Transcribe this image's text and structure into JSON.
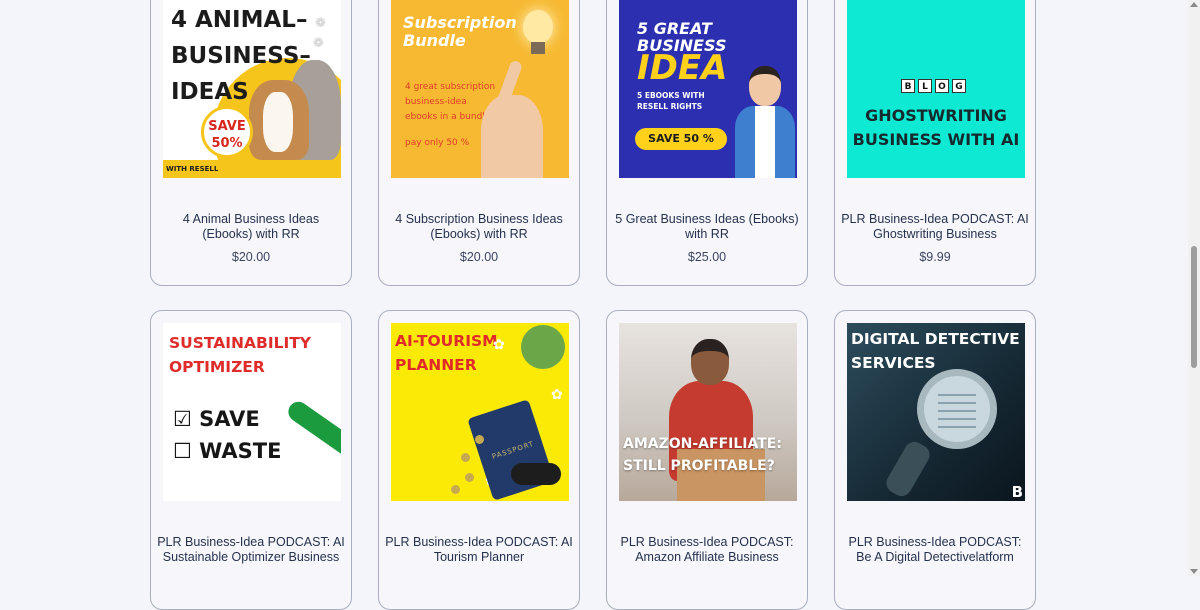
{
  "products": [
    {
      "title": "4 Animal Business Ideas (Ebooks) with RR",
      "price": "$20.00",
      "image_text": {
        "headline": "4 ANIMAL– BUSINESS– IDEAS",
        "line1": "4 ANIMAL–",
        "line2": "BUSINESS–",
        "line3": "IDEAS",
        "badge": "SAVE 50%",
        "badge1": "SAVE",
        "badge2": "50%",
        "footer": "WITH RESELL RIGHTS"
      }
    },
    {
      "title": "4 Subscription Business Ideas (Ebooks) with RR",
      "price": "$20.00",
      "image_text": {
        "line1": "Subscription",
        "line2": "Bundle",
        "desc1": "4 great subscription",
        "desc2": "business-idea",
        "desc3": "ebooks in a bundle",
        "offer": "pay only 50 %"
      }
    },
    {
      "title": "5 Great Business Ideas (Ebooks) with RR",
      "price": "$25.00",
      "image_text": {
        "line1": "5 GREAT",
        "line2": "BUSINESS",
        "big": "IDEA",
        "sub1": "5 EBOOKS WITH",
        "sub2": "RESELL RIGHTS",
        "badge": "SAVE 50 %"
      }
    },
    {
      "title": "PLR Business-Idea PODCAST: AI Ghostwriting Business",
      "price": "$9.99",
      "image_text": {
        "tiles": [
          "B",
          "L",
          "O",
          "G"
        ],
        "line1": "GHOSTWRITING",
        "line2": "BUSINESS WITH AI"
      }
    },
    {
      "title": "PLR Business-Idea PODCAST: AI Sustainable Optimizer Business",
      "image_text": {
        "line1": "SUSTAINABILITY",
        "line2": "OPTIMIZER",
        "opt1": "SAVE",
        "opt2": "WASTE"
      }
    },
    {
      "title": "PLR Business-Idea PODCAST: AI Tourism Planner",
      "image_text": {
        "line1": "AI-TOURISM",
        "line2": "PLANNER",
        "passport": "PASSPORT"
      }
    },
    {
      "title": "PLR Business-Idea PODCAST: Amazon Affiliate Business",
      "image_text": {
        "line1": "AMAZON-AFFILIATE:",
        "line2": "STILL PROFITABLE?"
      }
    },
    {
      "title": "PLR Business-Idea PODCAST: Be A Digital Detectivelatform",
      "image_text": {
        "line1": "DIGITAL DETECTIVE",
        "line2": "SERVICES",
        "corner": "B"
      }
    }
  ],
  "colors": {
    "background": "#f4f5fa",
    "card_border": "#a9afbf",
    "title": "#26324d",
    "price": "#3c4560"
  },
  "scrollbar": {
    "position_fraction": 0.43
  }
}
